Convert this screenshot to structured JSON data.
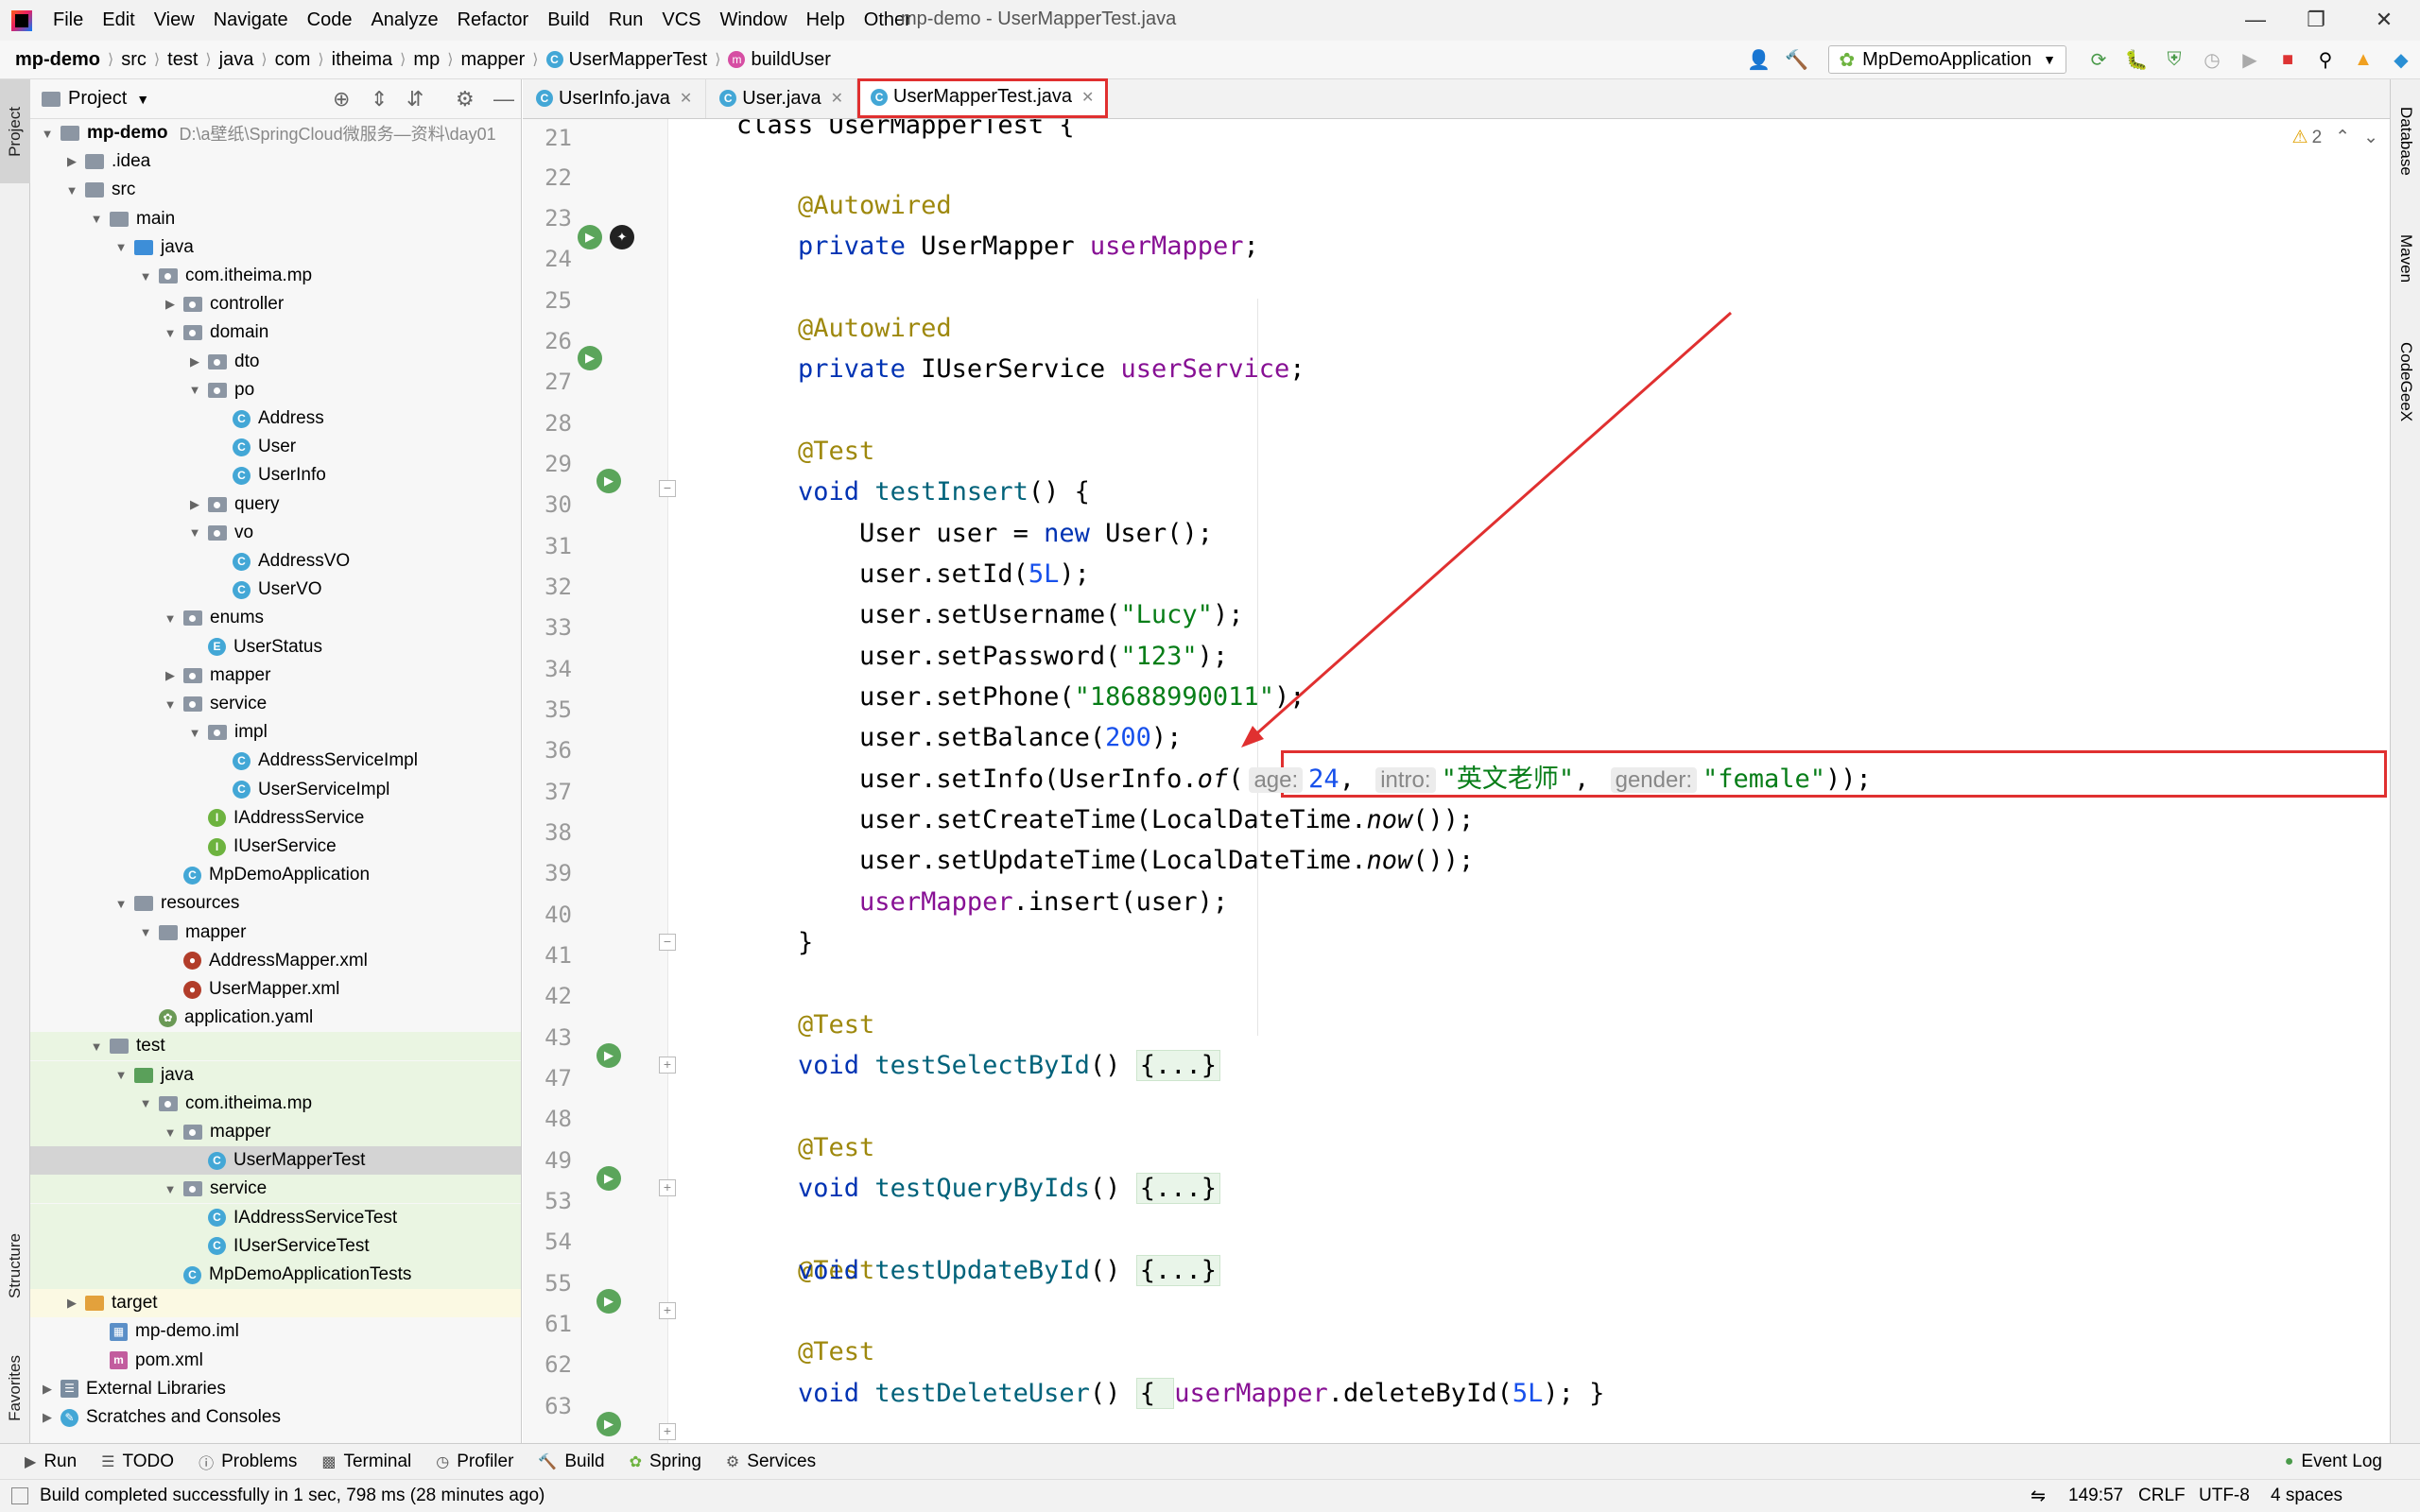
{
  "window": {
    "title": "mp-demo - UserMapperTest.java"
  },
  "menu": [
    "File",
    "Edit",
    "View",
    "Navigate",
    "Code",
    "Analyze",
    "Refactor",
    "Build",
    "Run",
    "VCS",
    "Window",
    "Help",
    "Other"
  ],
  "breadcrumb": [
    "mp-demo",
    "src",
    "test",
    "java",
    "com",
    "itheima",
    "mp",
    "mapper",
    "UserMapperTest",
    "buildUser"
  ],
  "run_config": "MpDemoApplication",
  "project_panel": {
    "title": "Project",
    "root_name": "mp-demo",
    "root_path": "D:\\a壁纸\\SpringCloud微服务—资料\\day01",
    "items": [
      {
        "label": ".idea",
        "kind": "folder"
      },
      {
        "label": "src",
        "kind": "folder"
      },
      {
        "label": "main",
        "kind": "folder"
      },
      {
        "label": "java",
        "kind": "folder-blue"
      },
      {
        "label": "com.itheima.mp",
        "kind": "pkg"
      },
      {
        "label": "controller",
        "kind": "pkg"
      },
      {
        "label": "domain",
        "kind": "pkg"
      },
      {
        "label": "dto",
        "kind": "pkg"
      },
      {
        "label": "po",
        "kind": "pkg"
      },
      {
        "label": "Address",
        "kind": "class"
      },
      {
        "label": "User",
        "kind": "class"
      },
      {
        "label": "UserInfo",
        "kind": "class"
      },
      {
        "label": "query",
        "kind": "pkg"
      },
      {
        "label": "vo",
        "kind": "pkg"
      },
      {
        "label": "AddressVO",
        "kind": "class"
      },
      {
        "label": "UserVO",
        "kind": "class"
      },
      {
        "label": "enums",
        "kind": "pkg"
      },
      {
        "label": "UserStatus",
        "kind": "enum"
      },
      {
        "label": "mapper",
        "kind": "pkg"
      },
      {
        "label": "service",
        "kind": "pkg"
      },
      {
        "label": "impl",
        "kind": "pkg"
      },
      {
        "label": "AddressServiceImpl",
        "kind": "class"
      },
      {
        "label": "UserServiceImpl",
        "kind": "class"
      },
      {
        "label": "IAddressService",
        "kind": "interface"
      },
      {
        "label": "IUserService",
        "kind": "interface"
      },
      {
        "label": "MpDemoApplication",
        "kind": "class"
      },
      {
        "label": "resources",
        "kind": "folder"
      },
      {
        "label": "mapper",
        "kind": "folder"
      },
      {
        "label": "AddressMapper.xml",
        "kind": "xml"
      },
      {
        "label": "UserMapper.xml",
        "kind": "xml"
      },
      {
        "label": "application.yaml",
        "kind": "yaml"
      },
      {
        "label": "test",
        "kind": "folder"
      },
      {
        "label": "java",
        "kind": "folder-green"
      },
      {
        "label": "com.itheima.mp",
        "kind": "pkg"
      },
      {
        "label": "mapper",
        "kind": "pkg"
      },
      {
        "label": "UserMapperTest",
        "kind": "class"
      },
      {
        "label": "service",
        "kind": "pkg"
      },
      {
        "label": "IAddressServiceTest",
        "kind": "class"
      },
      {
        "label": "IUserServiceTest",
        "kind": "class"
      },
      {
        "label": "MpDemoApplicationTests",
        "kind": "class"
      },
      {
        "label": "target",
        "kind": "folder-orange"
      },
      {
        "label": "mp-demo.iml",
        "kind": "iml"
      },
      {
        "label": "pom.xml",
        "kind": "maven"
      },
      {
        "label": "External Libraries",
        "kind": "lib"
      },
      {
        "label": "Scratches and Consoles",
        "kind": "scratch"
      }
    ]
  },
  "tabs": [
    {
      "label": "UserInfo.java"
    },
    {
      "label": "User.java"
    },
    {
      "label": "UserMapperTest.java",
      "active": true
    }
  ],
  "editor": {
    "warnings": "2",
    "line_numbers": [
      "21",
      "22",
      "23",
      "24",
      "25",
      "26",
      "27",
      "28",
      "29",
      "30",
      "31",
      "32",
      "33",
      "34",
      "35",
      "36",
      "37",
      "38",
      "39",
      "40",
      "41",
      "42",
      "43",
      "47",
      "48",
      "49",
      "53",
      "54",
      "55",
      "61",
      "62",
      "63"
    ],
    "tokens": {
      "autowired": "@Autowired",
      "test": "@Test",
      "private": "private",
      "void": "void",
      "new": "new",
      "usermapper_type": "UserMapper",
      "usermapper_field": "userMapper",
      "iuserservice_type": "IUserService",
      "userservice_field": "userService",
      "testInsert": "testInsert",
      "testSelectById": "testSelectById",
      "testQueryByIds": "testQueryByIds",
      "testUpdateById": "testUpdateById",
      "testDeleteUser": "testDeleteUser",
      "collapsed": "{...}",
      "hint_age": "age:",
      "hint_intro": "intro:",
      "hint_gender": "gender:",
      "val_age": "24",
      "val_intro": "\"英文老师\"",
      "val_gender": "\"female\"",
      "l30a": "User user = ",
      "l30b": "User();",
      "l31a": "user.setId(",
      "l31b": "5L",
      "l31c": ");",
      "l32a": "user.setUsername(",
      "l32b": "\"Lucy\"",
      "l32c": ");",
      "l33a": "user.setPassword(",
      "l33b": "\"123\"",
      "l33c": ");",
      "l34a": "user.setPhone(",
      "l34b": "\"18688990011\"",
      "l34c": ");",
      "l35a": "user.setBalance(",
      "l35b": "200",
      "l35c": ");",
      "l36a": "user.setInfo(UserInfo.",
      "l36b": "of",
      "l36c": "(",
      "l36d": ", ",
      "l36e": "));",
      "l37a": "user.setCreateTime(LocalDateTime.",
      "l37b": "now",
      "l37c": "());",
      "l38a": "user.setUpdateTime(LocalDateTime.",
      "l38b": "now",
      "l38c": "());",
      "l39b": ".insert(user);",
      "l63a": "{ ",
      "l63b": ".deleteById(",
      "l63c": "5L",
      "l63d": "); }",
      "l21": "class UserMapperTest {"
    }
  },
  "right_tools": [
    "Database",
    "Maven",
    "CodeGeeX"
  ],
  "left_tools": [
    "Project",
    "Structure",
    "Favorites"
  ],
  "bottom_tools": [
    "Run",
    "TODO",
    "Problems",
    "Terminal",
    "Profiler",
    "Build",
    "Spring",
    "Services"
  ],
  "event_log": "Event Log",
  "status": {
    "message": "Build completed successfully in 1 sec, 798 ms (28 minutes ago)",
    "position": "149:57",
    "line_sep": "CRLF",
    "encoding": "UTF-8",
    "indent": "4 spaces"
  }
}
